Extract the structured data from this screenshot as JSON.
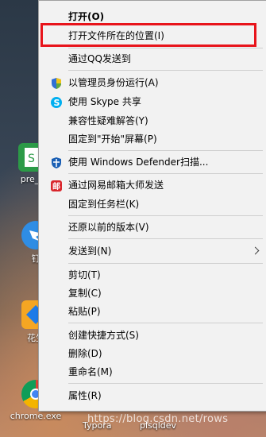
{
  "colors": {
    "menu_bg": "#f2f2f2",
    "highlight": "#e8141b",
    "separator": "#cfcfcf"
  },
  "desktop": {
    "icons": [
      {
        "label": "pre_p"
      },
      {
        "label": "钉"
      },
      {
        "label": "花生"
      },
      {
        "label": "chrome.exe"
      }
    ],
    "bottom_labels": [
      "Typora",
      "plsqldev"
    ]
  },
  "watermark": "https://blog.csdn.net/rows",
  "menu": {
    "items": [
      {
        "label": "打开(O)",
        "icon": ""
      },
      {
        "label": "打开文件所在的位置(I)",
        "icon": ""
      },
      {
        "label": "通过QQ发送到",
        "icon": ""
      },
      {
        "label": "以管理员身份运行(A)",
        "icon": "uac-shield-icon"
      },
      {
        "label": "使用 Skype 共享",
        "icon": "skype-icon"
      },
      {
        "label": "兼容性疑难解答(Y)",
        "icon": ""
      },
      {
        "label": "固定到\"开始\"屏幕(P)",
        "icon": ""
      },
      {
        "label": "使用 Windows Defender扫描...",
        "icon": "defender-shield-icon"
      },
      {
        "label": "通过网易邮箱大师发送",
        "icon": "netease-mail-icon"
      },
      {
        "label": "固定到任务栏(K)",
        "icon": ""
      },
      {
        "label": "还原以前的版本(V)",
        "icon": ""
      },
      {
        "label": "发送到(N)",
        "icon": "chevron-right-icon"
      },
      {
        "label": "剪切(T)",
        "icon": ""
      },
      {
        "label": "复制(C)",
        "icon": ""
      },
      {
        "label": "粘贴(P)",
        "icon": ""
      },
      {
        "label": "创建快捷方式(S)",
        "icon": ""
      },
      {
        "label": "删除(D)",
        "icon": ""
      },
      {
        "label": "重命名(M)",
        "icon": ""
      },
      {
        "label": "属性(R)",
        "icon": ""
      }
    ]
  }
}
